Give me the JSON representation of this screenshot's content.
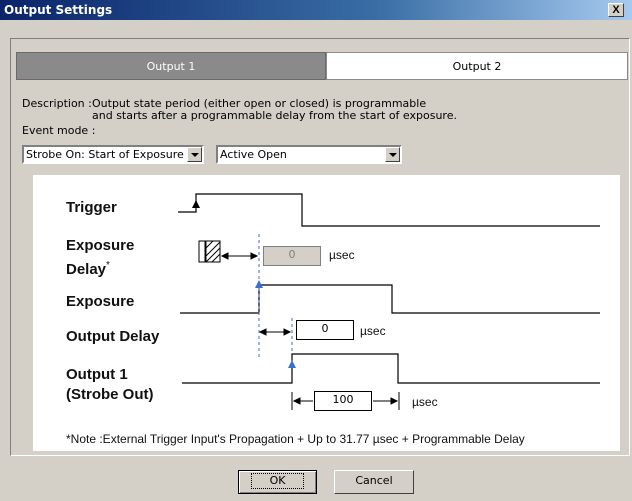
{
  "dialog": {
    "title": "Output Settings",
    "close_label": "X"
  },
  "tabs": [
    {
      "label": "Output 1",
      "selected": false
    },
    {
      "label": "Output 2",
      "selected": true
    }
  ],
  "description": {
    "label": "Description :",
    "line1": "Output state period (either open or closed) is programmable",
    "line2": "and starts after a programmable delay from the start of exposure."
  },
  "event_mode": {
    "label": "Event mode :",
    "strobe_select": "Strobe On: Start of Exposure",
    "state_select": "Active Open"
  },
  "timing_diagram": {
    "signals": {
      "trigger": "Trigger",
      "exposure_delay_line1": "Exposure",
      "exposure_delay_line2": "Delay",
      "exposure_delay_asterisk": "*",
      "exposure": "Exposure",
      "output_delay": "Output Delay",
      "output1_line1": "Output 1",
      "output1_line2": "(Strobe Out)"
    },
    "exposure_delay_value": "0",
    "output_delay_value": "0",
    "output_duration_value": "100",
    "unit": "µsec",
    "note": "*Note :External Trigger Input's Propagation + Up to 31.77  µsec + Programmable Delay"
  },
  "buttons": {
    "ok": "OK",
    "cancel": "Cancel"
  },
  "colors": {
    "title_bar": "#0a246a",
    "marker_blue": "#3a6fd0",
    "dialog_bg": "#d4d0c8"
  }
}
